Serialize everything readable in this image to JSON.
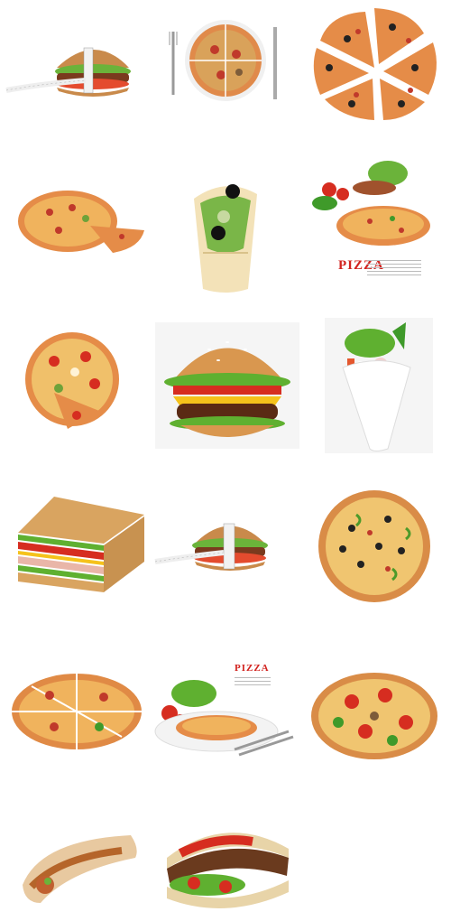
{
  "gallery": {
    "items": [
      {
        "subject": "burger-with-measuring-tape"
      },
      {
        "subject": "sliced-pizza-with-fork-and-knife"
      },
      {
        "subject": "separated-pizza-slices"
      },
      {
        "subject": "pizza-with-cut-slices"
      },
      {
        "subject": "tortilla-wrap-with-olives"
      },
      {
        "subject": "pizza-with-salad-and-tomatoes"
      },
      {
        "subject": "vegetable-pizza-with-slice"
      },
      {
        "subject": "cheeseburger"
      },
      {
        "subject": "salad-in-paper-cone"
      },
      {
        "subject": "club-sandwich"
      },
      {
        "subject": "burger-with-measuring-tape"
      },
      {
        "subject": "olive-and-pepper-pizza"
      },
      {
        "subject": "pizza-cut-into-slices"
      },
      {
        "subject": "pizza-plate-with-salad-and-cutlery"
      },
      {
        "subject": "tomato-pizza"
      },
      {
        "subject": "meat-wrap"
      },
      {
        "subject": "kebab-sandwich"
      }
    ],
    "captions": {
      "pizza_a": "PIZZA",
      "pizza_b": "PIZZA"
    }
  }
}
